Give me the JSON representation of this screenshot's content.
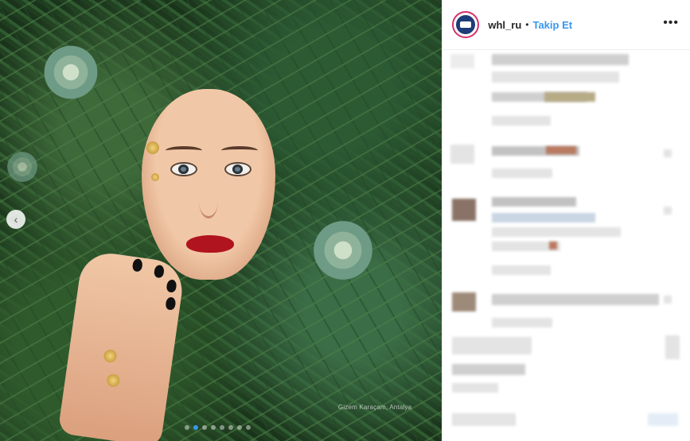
{
  "post": {
    "username": "whl_ru",
    "separator": "•",
    "follow_label": "Takip Et",
    "more_label": "•••",
    "photo_credit": "Gizem Karaçam, Antalya",
    "carousel": {
      "slides": 8,
      "active": 1
    },
    "prev_icon": "‹"
  },
  "colors": {
    "follow": "#3897f0",
    "avatar_ring": "#d4316a",
    "username": "#262626"
  }
}
